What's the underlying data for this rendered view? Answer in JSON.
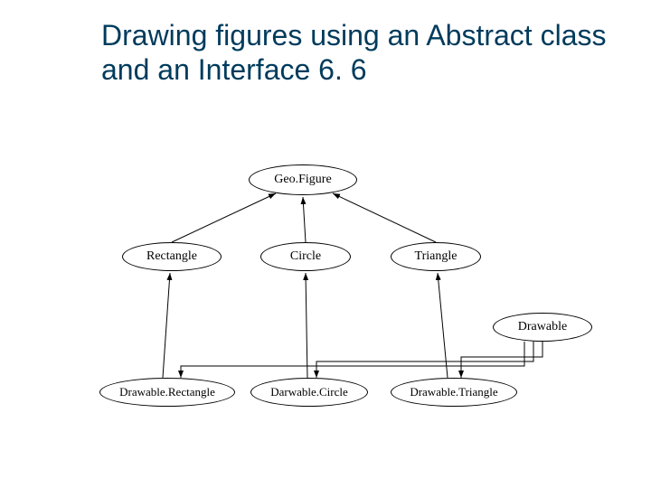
{
  "title": "Drawing figures using an Abstract class and an Interface 6. 6",
  "nodes": {
    "geofigure": "Geo.Figure",
    "rectangle": "Rectangle",
    "circle": "Circle",
    "triangle": "Triangle",
    "drawable": "Drawable",
    "drawable_rectangle": "Drawable.Rectangle",
    "darwable_circle": "Darwable.Circle",
    "drawable_triangle": "Drawable.Triangle"
  }
}
